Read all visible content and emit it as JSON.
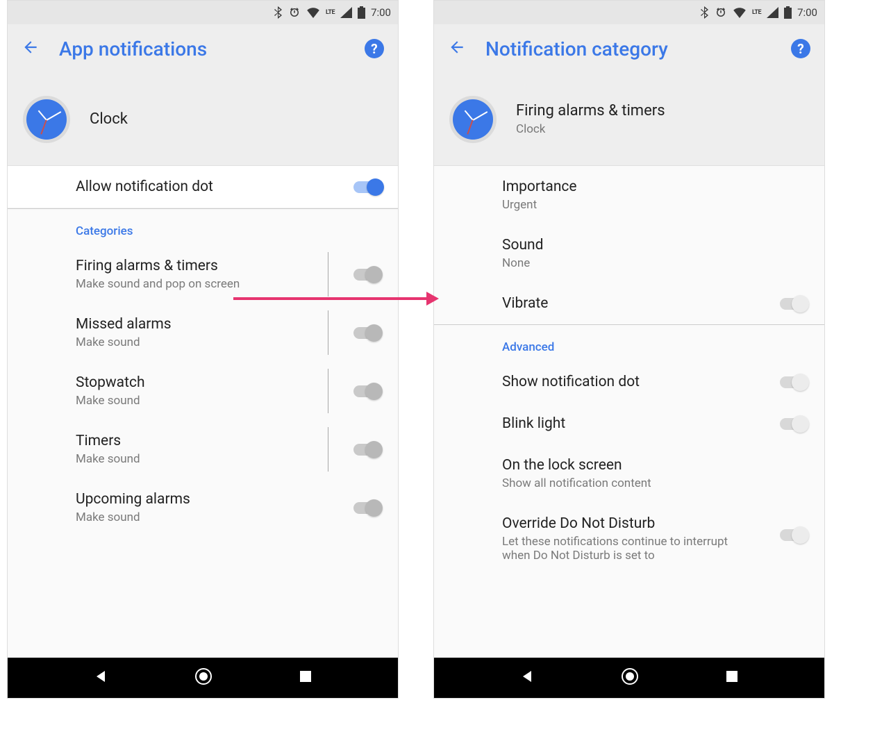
{
  "status": {
    "time": "7:00",
    "lte": "LTE"
  },
  "left": {
    "title": "App notifications",
    "app_name": "Clock",
    "allow_dot": "Allow notification dot",
    "section": "Categories",
    "cats": [
      {
        "title": "Firing alarms & timers",
        "sub": "Make sound and pop on screen"
      },
      {
        "title": "Missed alarms",
        "sub": "Make sound"
      },
      {
        "title": "Stopwatch",
        "sub": "Make sound"
      },
      {
        "title": "Timers",
        "sub": "Make sound"
      },
      {
        "title": "Upcoming alarms",
        "sub": "Make sound"
      }
    ]
  },
  "right": {
    "title": "Notification category",
    "head_primary": "Firing alarms & timers",
    "head_secondary": "Clock",
    "importance_label": "Importance",
    "importance_value": "Urgent",
    "sound_label": "Sound",
    "sound_value": "None",
    "vibrate": "Vibrate",
    "section": "Advanced",
    "show_dot": "Show notification dot",
    "blink": "Blink light",
    "lock_label": "On the lock screen",
    "lock_value": "Show all notification content",
    "override_label": "Override Do Not Disturb",
    "override_sub": "Let these notifications continue to interrupt when Do Not Disturb is set to"
  }
}
